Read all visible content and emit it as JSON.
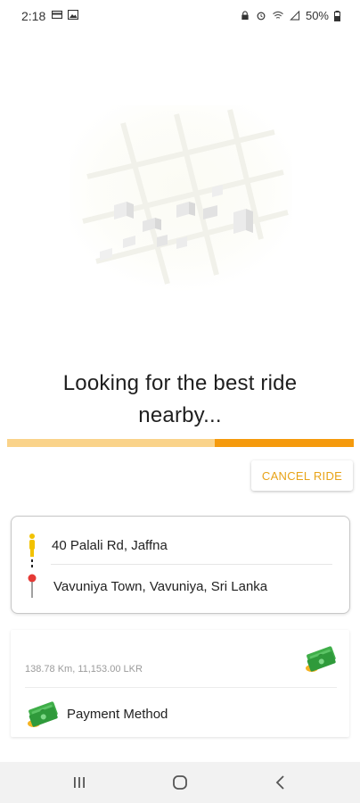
{
  "status_bar": {
    "time": "2:18",
    "battery": "50%",
    "icons_left": [
      "card-icon",
      "image-icon"
    ],
    "icons_right": [
      "lock-icon",
      "alarm-icon",
      "wifi-icon",
      "signal-icon",
      "battery-icon"
    ]
  },
  "search": {
    "title_line1": "Looking for the best ride",
    "title_line2": "nearby...",
    "progress_fraction": 0.4
  },
  "actions": {
    "cancel_label": "CANCEL RIDE"
  },
  "route": {
    "pickup": "40 Palali Rd, Jaffna",
    "destination": "Vavuniya Town, Vavuniya, Sri Lanka"
  },
  "fare": {
    "summary": "138.78 Km, 11,153.00 LKR",
    "payment_label": "Payment Method"
  },
  "colors": {
    "accent": "#f59a0d",
    "accent_light": "#fad38a",
    "cancel_text": "#e8a318",
    "pickup_pin": "#f2c200",
    "destination_pin": "#e53935"
  }
}
